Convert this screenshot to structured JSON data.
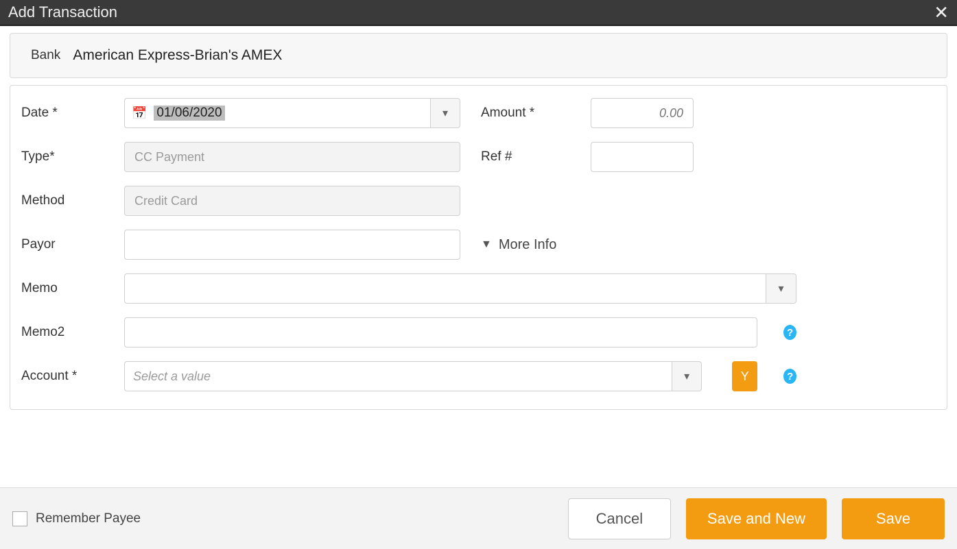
{
  "dialog": {
    "title": "Add Transaction"
  },
  "bank": {
    "label": "Bank",
    "value": "American Express-Brian's AMEX"
  },
  "form": {
    "date_label": "Date *",
    "date_value": "01/06/2020",
    "type_label": "Type*",
    "type_value": "CC Payment",
    "method_label": "Method",
    "method_value": "Credit Card",
    "payor_label": "Payor",
    "payor_value": "",
    "amount_label": "Amount *",
    "amount_placeholder": "0.00",
    "ref_label": "Ref #",
    "ref_value": "",
    "moreinfo_label": "More Info",
    "memo_label": "Memo",
    "memo_value": "",
    "memo2_label": "Memo2",
    "memo2_value": "",
    "account_label": "Account *",
    "account_placeholder": "Select a value",
    "y_button": "Y"
  },
  "footer": {
    "remember_label": "Remember Payee",
    "cancel": "Cancel",
    "save_new": "Save and New",
    "save": "Save"
  }
}
